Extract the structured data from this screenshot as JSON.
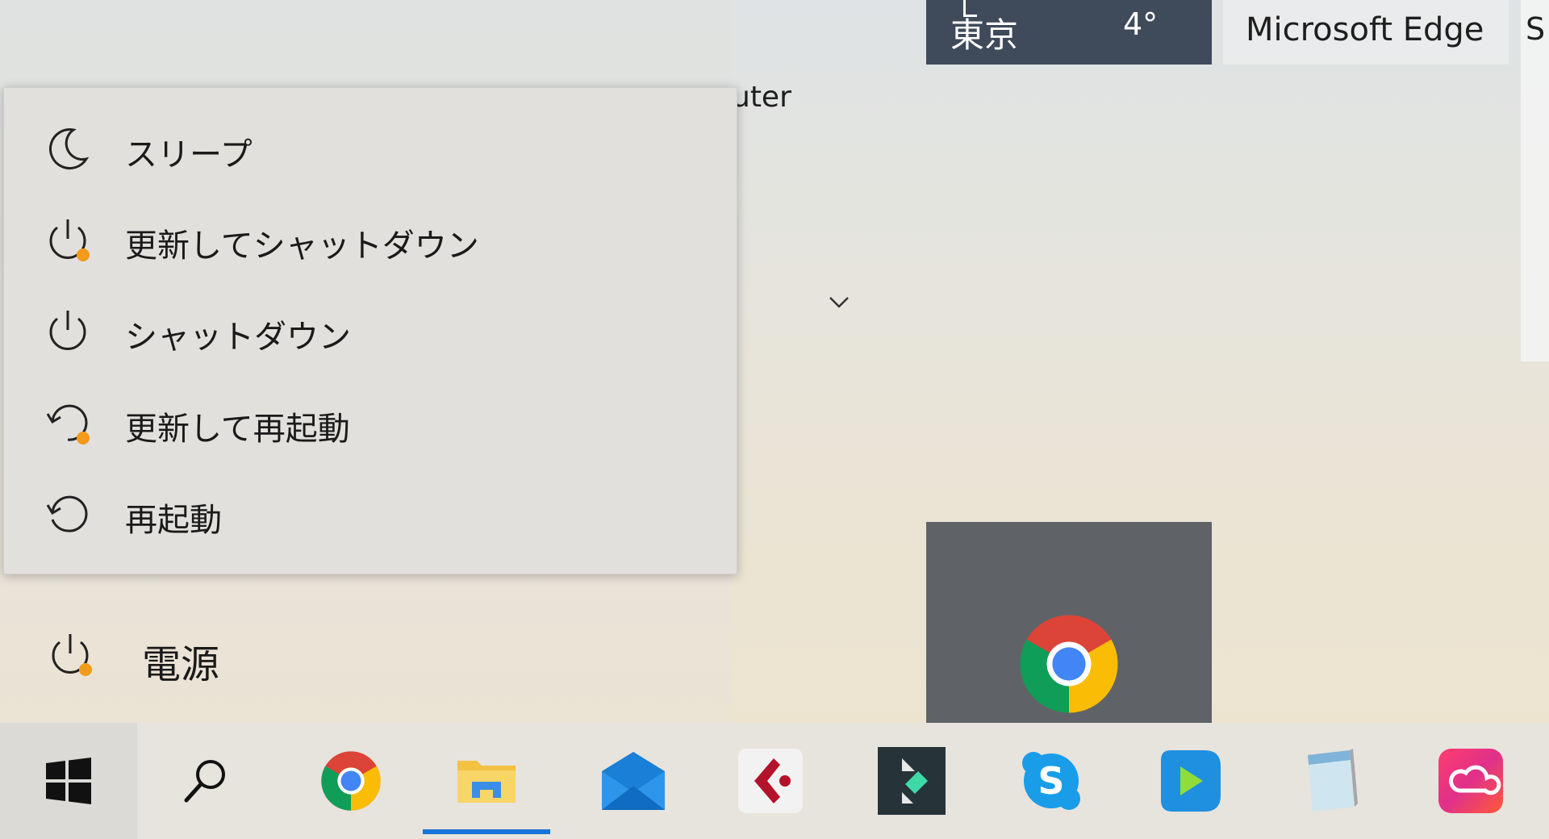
{
  "tiles": {
    "weather": {
      "city": "東京",
      "temp": "4°"
    },
    "edge": {
      "label": "Microsoft Edge",
      "right_glyph": "S"
    },
    "chrome_tile": {
      "icon": "chrome-icon"
    },
    "peek_text": "uter"
  },
  "power_menu": {
    "items": [
      {
        "label": "スリープ",
        "icon": "moon-icon"
      },
      {
        "label": "更新してシャットダウン",
        "icon": "power-update-icon"
      },
      {
        "label": "シャットダウン",
        "icon": "power-icon"
      },
      {
        "label": "更新して再起動",
        "icon": "restart-update-icon"
      },
      {
        "label": "再起動",
        "icon": "restart-icon"
      }
    ]
  },
  "power_button": {
    "label": "電源",
    "icon": "power-update-icon"
  },
  "colors": {
    "accent": "#1a73d9",
    "update_dot": "#f29a1c",
    "tile_dark": "#3f4a5a",
    "chrome_tile": "#5f6368"
  },
  "taskbar": {
    "apps": [
      {
        "name": "start-button",
        "icon": "windows-logo-icon"
      },
      {
        "name": "search-button",
        "icon": "search-icon"
      },
      {
        "name": "chrome-taskbar-button",
        "icon": "chrome-icon"
      },
      {
        "name": "file-explorer-taskbar-button",
        "icon": "folder-icon",
        "active": true
      },
      {
        "name": "mail-taskbar-button",
        "icon": "mail-icon"
      },
      {
        "name": "cubase-taskbar-button",
        "icon": "cubase-icon"
      },
      {
        "name": "filmora-taskbar-button",
        "icon": "filmora-icon"
      },
      {
        "name": "skype-taskbar-button",
        "icon": "skype-icon"
      },
      {
        "name": "media-player-taskbar-button",
        "icon": "play-icon"
      },
      {
        "name": "notepad-taskbar-button",
        "icon": "notepad-icon"
      },
      {
        "name": "creative-cloud-taskbar-button",
        "icon": "creative-cloud-icon"
      }
    ]
  }
}
